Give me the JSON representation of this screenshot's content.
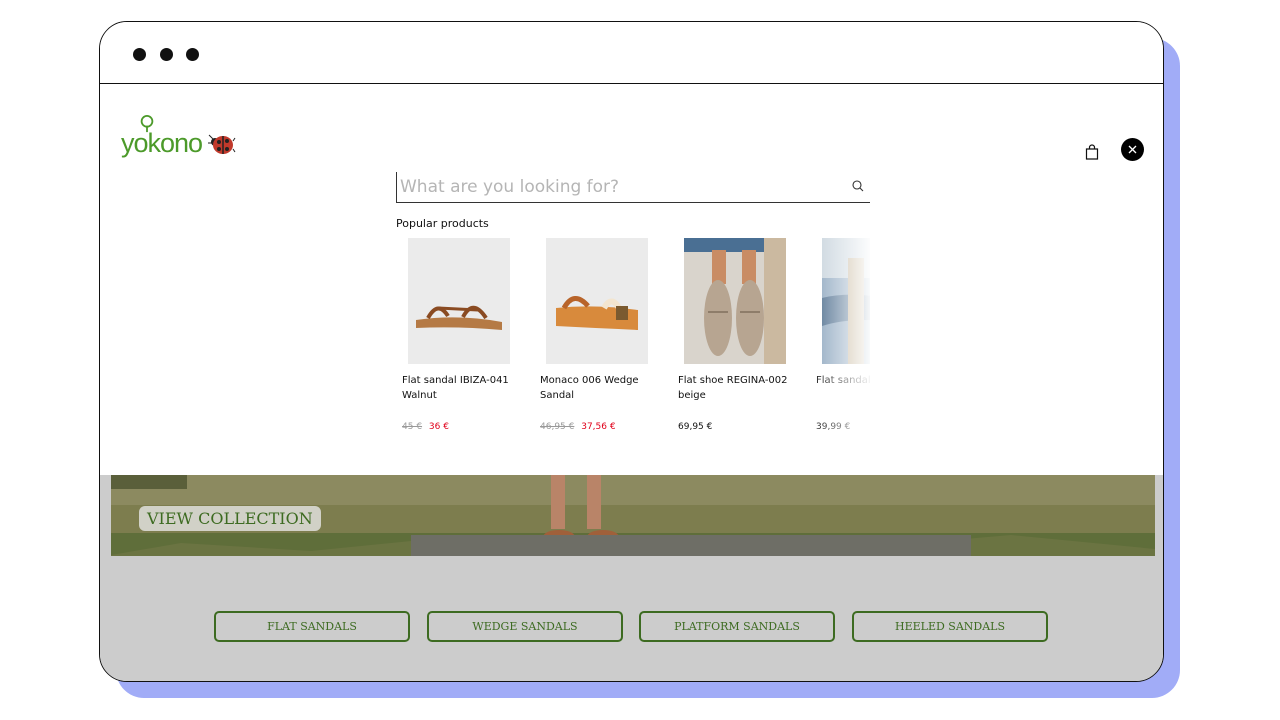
{
  "brand": {
    "name": "yokono"
  },
  "search": {
    "placeholder": "What are you looking for?"
  },
  "popular": {
    "heading": "Popular products",
    "items": [
      {
        "name": "Flat sandal IBIZA-041 Walnut",
        "old_price": "45 €",
        "price": "36 €"
      },
      {
        "name": "Monaco 006 Wedge Sandal",
        "old_price": "46,95 €",
        "price": "37,56 €"
      },
      {
        "name": "Flat shoe REGINA-002 beige",
        "old_price": "",
        "price": "69,95 €"
      },
      {
        "name": "Flat sandal blue",
        "old_price": "",
        "price": "39,99 €"
      }
    ]
  },
  "hero": {
    "cta_label": "VIEW COLLECTION"
  },
  "categories": [
    "FLAT SANDALS",
    "WEDGE SANDALS",
    "PLATFORM SANDALS",
    "HEELED SANDALS"
  ],
  "colors": {
    "accent": "#3d6b21",
    "brand_green": "#4c9a2a",
    "sale_red": "#e0001a",
    "frame_shadow": "#a1acf7"
  },
  "icons": {
    "bag": "shopping-bag-icon",
    "close": "close-icon",
    "search": "search-icon"
  }
}
